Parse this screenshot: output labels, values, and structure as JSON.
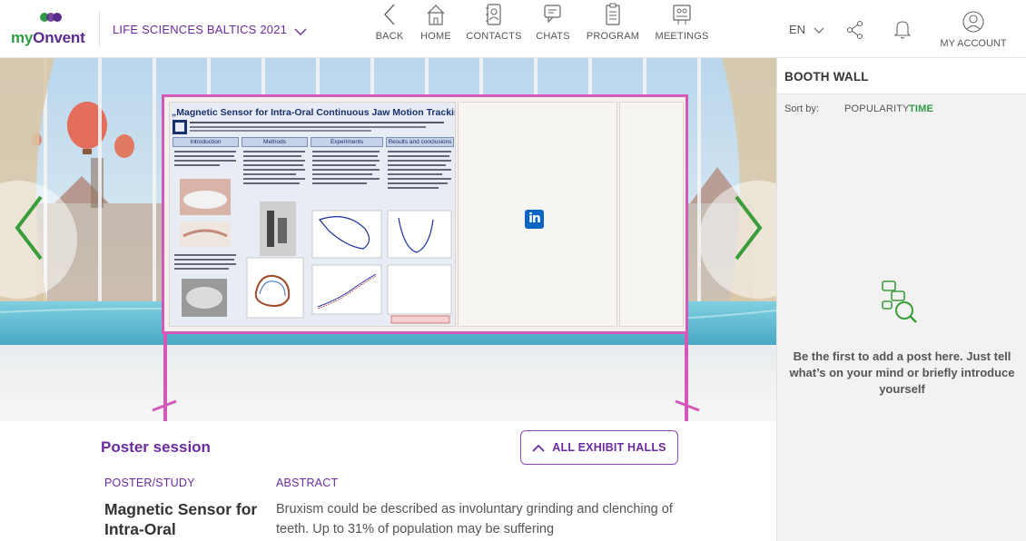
{
  "header": {
    "logo": {
      "text_my": "my",
      "text_onvent": "Onvent"
    },
    "event_selector": "LIFE SCIENCES BALTICS 2021",
    "nav": [
      {
        "label": "BACK",
        "icon": "chevron-left-icon"
      },
      {
        "label": "HOME",
        "icon": "home-icon"
      },
      {
        "label": "CONTACTS",
        "icon": "contacts-icon"
      },
      {
        "label": "CHATS",
        "icon": "chat-icon"
      },
      {
        "label": "PROGRAM",
        "icon": "program-icon"
      },
      {
        "label": "MEETINGS",
        "icon": "meetings-icon"
      }
    ],
    "language": "EN",
    "account_label": "MY ACCOUNT"
  },
  "poster": {
    "title": "„Magnetic Sensor for Intra-Oral Continuous Jaw Motion Tracking”",
    "sections": [
      "Introduction",
      "Methods",
      "Experiments",
      "Results and conclusions"
    ],
    "linkedin": "in"
  },
  "content": {
    "section_title": "Poster session",
    "halls_button": "ALL EXHIBIT HALLS",
    "poster_label": "POSTER/STUDY",
    "abstract_label": "ABSTRACT",
    "poster_name": "Magnetic Sensor for Intra-Oral",
    "abstract_text": "Bruxism could be described as involuntary grinding and clenching of teeth. Up to 31% of population may be suffering"
  },
  "booth_wall": {
    "title": "BOOTH WALL",
    "sort_label": "Sort by:",
    "sort_options": [
      "POPULARITY",
      "TIME"
    ],
    "active_sort": "TIME",
    "empty_text": "Be the first to add a post here. Just tell what’s on your mind or briefly introduce yourself"
  },
  "colors": {
    "brand_purple": "#6a2b9e",
    "brand_green": "#2f9c45",
    "board_pink": "#d358b8",
    "arrow_green": "#3a9d3a"
  }
}
